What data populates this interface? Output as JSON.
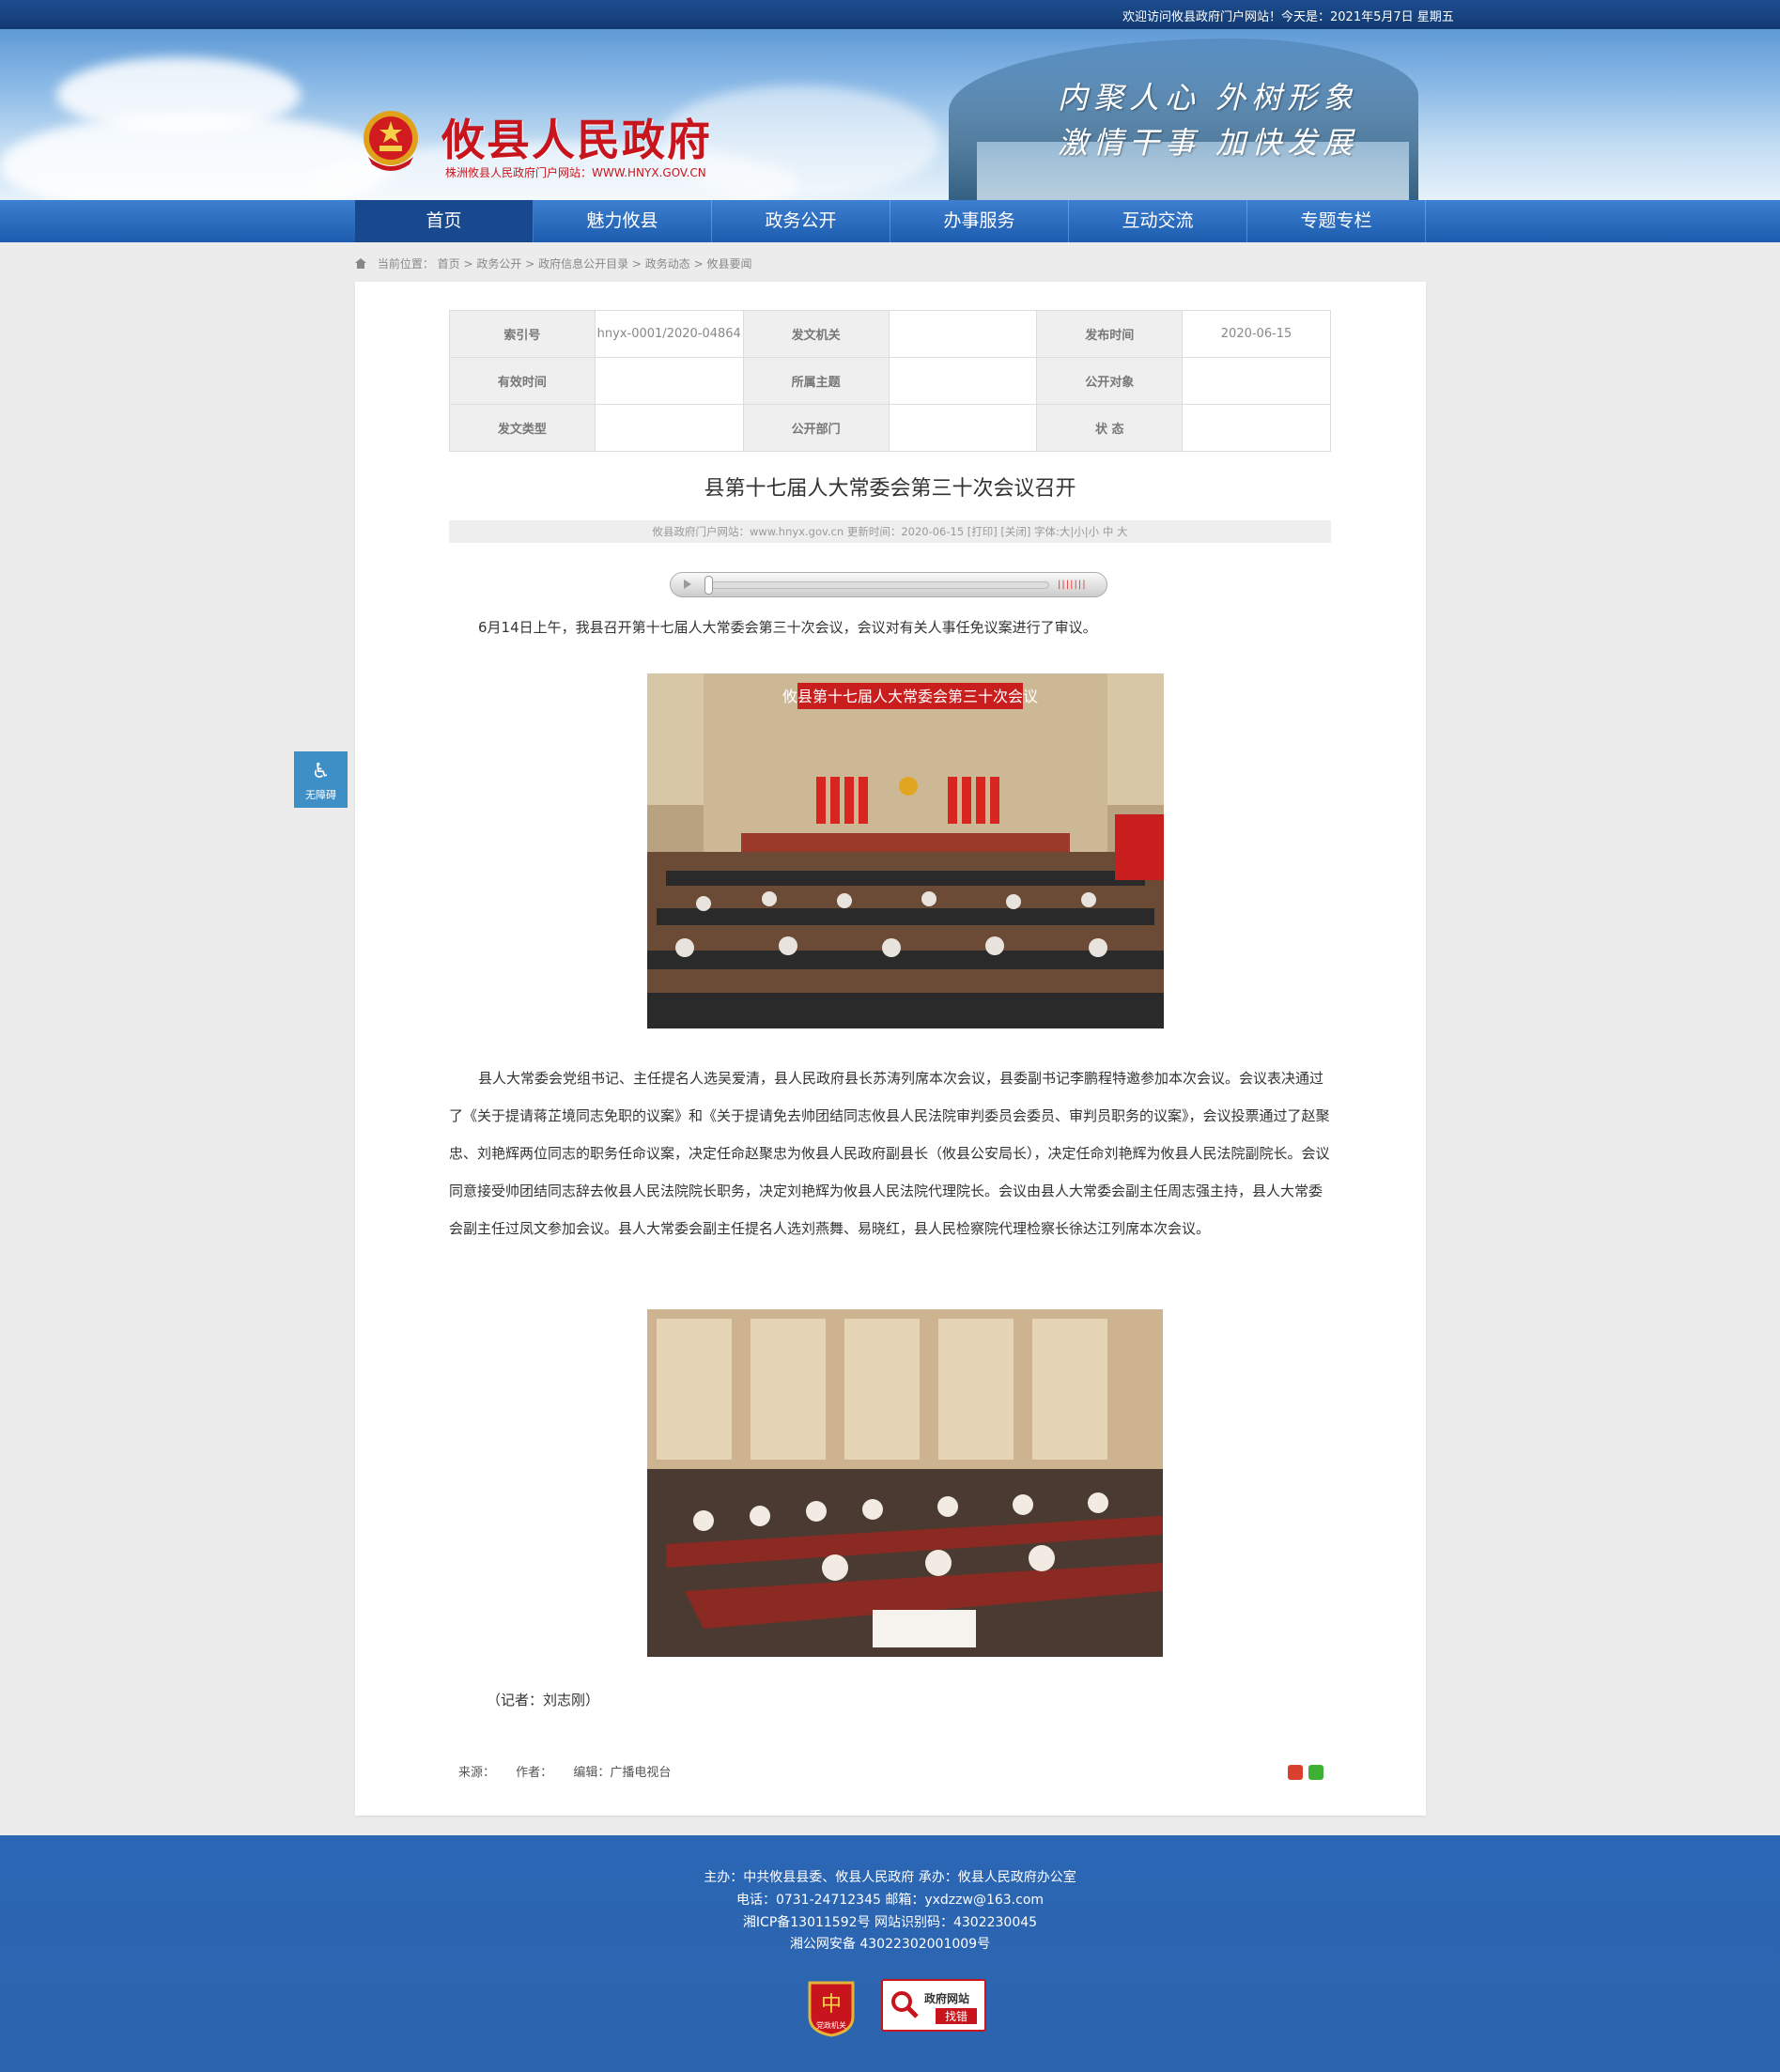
{
  "topbar": {
    "welcome": "欢迎访问攸县政府门户网站！今天是：2021年5月7日 星期五"
  },
  "header": {
    "title": "攸县人民政府",
    "subtitle": "株洲攸县人民政府门户网站：WWW.HNYX.GOV.CN",
    "slogan1": "内聚人心 外树形象",
    "slogan2": "激情干事 加快发展"
  },
  "nav": {
    "items": [
      "首页",
      "魅力攸县",
      "政务公开",
      "办事服务",
      "互动交流",
      "专题专栏"
    ]
  },
  "breadcrumb": {
    "label": "当前位置：",
    "items": [
      "首页",
      "政务公开",
      "政府信息公开目录",
      "政务动态",
      "攸县要闻"
    ],
    "separator": " > "
  },
  "meta": {
    "index_label": "索引号",
    "index_value": "hnyx-0001/2020-04864",
    "issuer_label": "发文机关",
    "issuer_value": "",
    "date_label": "发布时间",
    "date_value": "2020-06-15",
    "valid_label": "有效时间",
    "valid_value": "",
    "topic_label": "所属主题",
    "topic_value": "",
    "audience_label": "公开对象",
    "audience_value": "",
    "type_label": "发文类型",
    "type_value": "",
    "dept_label": "公开部门",
    "dept_value": "",
    "status_label": "状  态",
    "status_value": ""
  },
  "article": {
    "title": "县第十七届人大常委会第三十次会议召开",
    "info": "攸县政府门户网站：www.hnyx.gov.cn   更新时间：2020-06-15   [打印] [关闭]   字体:大|小|小 中 大",
    "para1": "6月14日上午，我县召开第十七届人大常委会第三十次会议，会议对有关人事任免议案进行了审议。",
    "photo1_banner": "攸县第十七届人大常委会第三十次会议",
    "para2": "县人大常委会党组书记、主任提名人选吴爱清，县人民政府县长苏涛列席本次会议，县委副书记李鹏程特邀参加本次会议。会议表决通过了《关于提请蒋芷境同志免职的议案》和《关于提请免去帅团结同志攸县人民法院审判委员会委员、审判员职务的议案》，会议投票通过了赵聚忠、刘艳辉两位同志的职务任命议案，决定任命赵聚忠为攸县人民政府副县长（攸县公安局长），决定任命刘艳辉为攸县人民法院副院长。会议同意接受帅团结同志辞去攸县人民法院院长职务，决定刘艳辉为攸县人民法院代理院长。会议由县人大常委会副主任周志强主持，县人大常委会副主任过凤文参加会议。县人大常委会副主任提名人选刘燕舞、易晓红，县人民检察院代理检察长徐达江列席本次会议。",
    "reporter": "（记者：刘志刚）",
    "source_label": "来源：",
    "author_label": "作者：",
    "editor_label": "编辑：广播电视台"
  },
  "accessibility": {
    "label": "无障碍",
    "icon": "wheelchair-icon"
  },
  "footer": {
    "line1": "主办：中共攸县县委、攸县人民政府 承办：攸县人民政府办公室",
    "line2": "电话：0731-24712345 邮箱：yxdzzw@163.com",
    "line3": "湘ICP备13011592号    网站识别码：4302230045",
    "line4": "湘公网安备 43022302001009号",
    "badge_party": "党政机关",
    "badge_err_1": "政府网站",
    "badge_err_2": "找错"
  },
  "colors": {
    "nav_blue": "#2a6bbf",
    "title_red": "#c8151d",
    "footer_blue": "#2b66b5"
  }
}
